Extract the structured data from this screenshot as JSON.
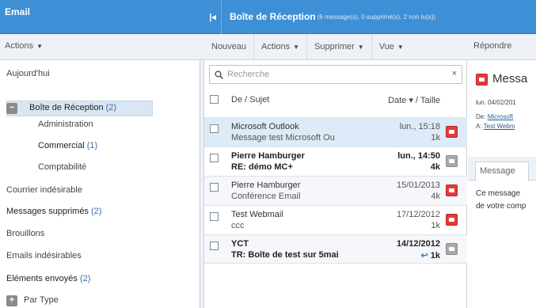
{
  "header": {
    "left_title": "Email",
    "collapse_glyph": "|◂",
    "title": "Boîte de Réception",
    "subtitle": "(6 message(s), 0 supprimé(s), 2 non lu(s))"
  },
  "sidebar": {
    "actions_label": "Actions",
    "items": [
      {
        "label": "Aujourd'hui",
        "count": ""
      },
      {
        "label": "Boîte de Réception",
        "count": "(2)"
      },
      {
        "label": "Administration",
        "count": ""
      },
      {
        "label": "Commercial",
        "count": "(1)"
      },
      {
        "label": "Comptabilité",
        "count": ""
      },
      {
        "label": "Courrier indésirable",
        "count": ""
      },
      {
        "label": "Messages supprimés",
        "count": "(2)"
      },
      {
        "label": "Brouillons",
        "count": ""
      },
      {
        "label": "Emails indésirables",
        "count": ""
      },
      {
        "label": "Eléments envoyés",
        "count": "(2)"
      },
      {
        "label": "Par Type",
        "count": ""
      }
    ],
    "collapse_glyph": "−",
    "expand_glyph": "+"
  },
  "toolbar": {
    "new_label": "Nouveau",
    "actions_label": "Actions",
    "delete_label": "Supprimer",
    "view_label": "Vue",
    "reply_label": "Répondre"
  },
  "search": {
    "placeholder": "Recherche",
    "clear": "×",
    "icon": "search-icon"
  },
  "list": {
    "header_from": "De / Sujet",
    "header_date": "Date ▾ / Taille",
    "rows": [
      {
        "from": "Microsoft Outlook",
        "subject": "Message test Microsoft Ou",
        "date": "lun., 15:18",
        "size": "1k",
        "flag": "red"
      },
      {
        "from": "Pierre Hamburger",
        "subject": "RE: démo MC+",
        "date": "lun., 14:50",
        "size": "4k",
        "flag": "grey"
      },
      {
        "from": "Pierre Hamburger",
        "subject": "Conférence Email",
        "date": "15/01/2013",
        "size": "4k",
        "flag": "red"
      },
      {
        "from": "Test Webmail",
        "subject": "ccc",
        "date": "17/12/2012",
        "size": "1k",
        "flag": "red"
      },
      {
        "from": "YCT",
        "subject": "TR: Boîte de test sur 5mai",
        "date": "14/12/2012",
        "size": "1k",
        "flag": "grey",
        "reply_glyph": "↩"
      }
    ]
  },
  "preview": {
    "subject": "Messa",
    "date_line": "lun. 04/02/201",
    "from_label": "De:",
    "from_value": "Microsoft",
    "to_label": "A:",
    "to_value": "Test Webm",
    "tab_label": "Message",
    "body_line1": "Ce message",
    "body_line2": "de votre comp"
  },
  "colors": {
    "header_blue": "#3d8fd6",
    "toolbar_bg": "#eef2f7",
    "selected_row": "#ddeaf7",
    "flag_red": "#e23a3a"
  }
}
